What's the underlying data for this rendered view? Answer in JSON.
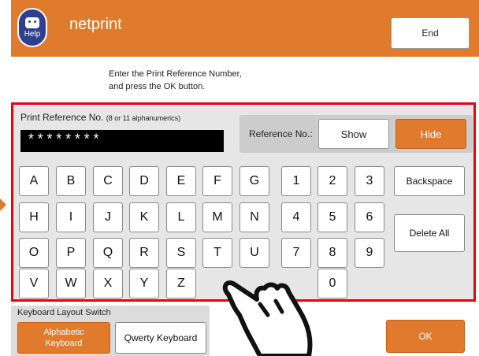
{
  "header": {
    "help_label": "Help",
    "app_title": "netprint",
    "end_label": "End",
    "brand_color": "#e07a2c"
  },
  "instructions": {
    "line1": "Enter the Print Reference Number,",
    "line2": "and press the OK button."
  },
  "reference": {
    "label": "Print Reference No.",
    "hint": "(8 or 11 alphanumerics)",
    "value": "********",
    "toggle_label": "Reference No.:",
    "show_label": "Show",
    "hide_label": "Hide",
    "selected": "Hide"
  },
  "letters": [
    "A",
    "B",
    "C",
    "D",
    "E",
    "F",
    "G",
    "H",
    "I",
    "J",
    "K",
    "L",
    "M",
    "N",
    "O",
    "P",
    "Q",
    "R",
    "S",
    "T",
    "U",
    "V",
    "W",
    "X",
    "Y",
    "Z"
  ],
  "digits": [
    "1",
    "2",
    "3",
    "4",
    "5",
    "6",
    "7",
    "8",
    "9",
    "0"
  ],
  "actions": {
    "backspace_label": "Backspace",
    "delete_all_label": "Delete All"
  },
  "layout_switch": {
    "label": "Keyboard Layout Switch",
    "alphabetic_line1": "Alphabetic",
    "alphabetic_line2": "Keyboard",
    "qwerty_label": "Qwerty Keyboard",
    "selected": "Alphabetic Keyboard"
  },
  "ok_label": "OK",
  "highlight_color": "#e60012",
  "icons": {
    "help": "help-robot-icon",
    "pointer": "pointing-hand-icon"
  }
}
